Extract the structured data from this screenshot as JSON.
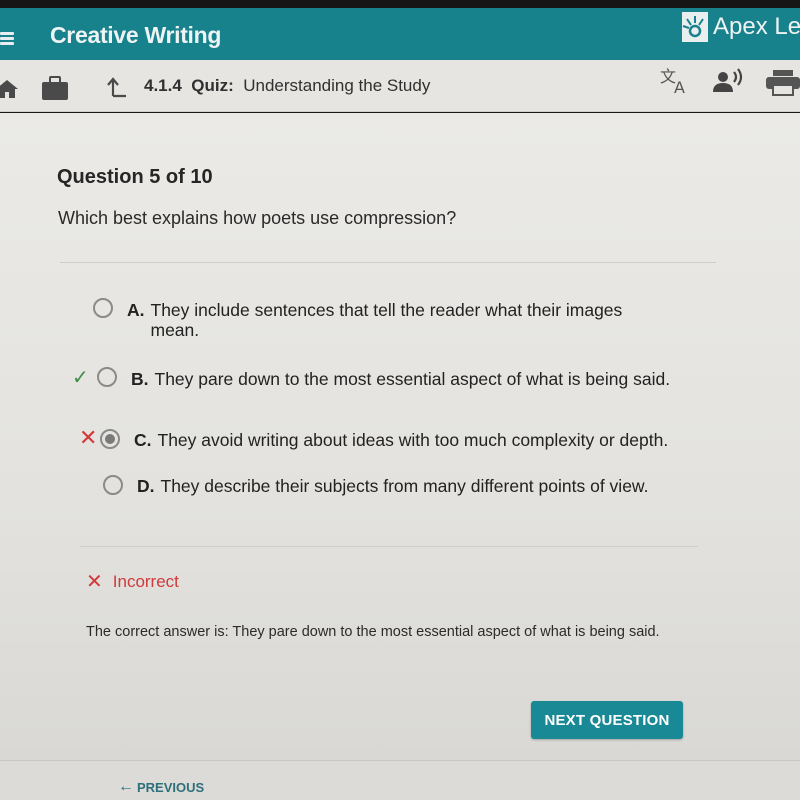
{
  "header": {
    "app_title": "Creative Writing",
    "brand_name": "Apex Lea",
    "brand_color": "#17818c"
  },
  "subheader": {
    "lesson_number": "4.1.4",
    "lesson_type": "Quiz:",
    "lesson_title": "Understanding the Study",
    "icons": [
      "home-icon",
      "briefcase-icon",
      "up-arrow-icon",
      "translate-icon",
      "audio-icon",
      "print-icon"
    ]
  },
  "question": {
    "number_label": "Question 5 of 10",
    "text": "Which best explains how poets use compression?",
    "options": [
      {
        "letter": "A.",
        "text": "They include sentences that tell the reader what their images mean.",
        "selected": false,
        "mark": ""
      },
      {
        "letter": "B.",
        "text": "They pare down to the most essential aspect of what is being said.",
        "selected": false,
        "mark": "✓"
      },
      {
        "letter": "C.",
        "text": "They avoid writing about ideas with too much complexity or depth.",
        "selected": true,
        "mark": "✕"
      },
      {
        "letter": "D.",
        "text": "They describe their subjects from many different points of view.",
        "selected": false,
        "mark": ""
      }
    ]
  },
  "feedback": {
    "icon": "✕",
    "status": "Incorrect",
    "status_color": "#d03a3a",
    "correct_answer_text": "The correct answer is: They pare down to the most essential aspect of what is being said."
  },
  "actions": {
    "next_label": "NEXT QUESTION",
    "previous_arrow": "←",
    "previous_label": "PREVIOUS"
  }
}
